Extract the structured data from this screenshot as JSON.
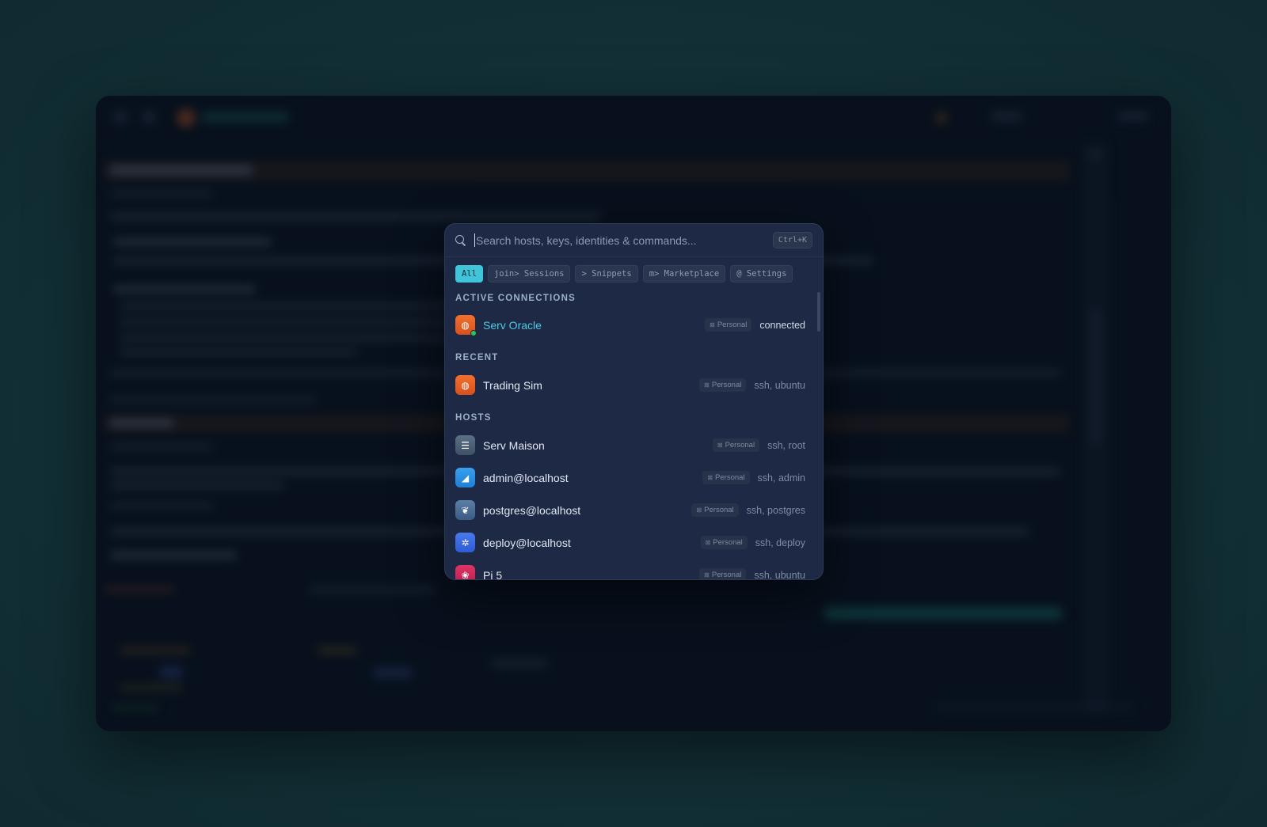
{
  "search": {
    "placeholder": "Search hosts, keys, identities & commands...",
    "shortcut": "Ctrl+K"
  },
  "filters": [
    {
      "label": "All",
      "active": true
    },
    {
      "label": "join> Sessions"
    },
    {
      "label": "> Snippets"
    },
    {
      "label": "m> Marketplace"
    },
    {
      "label": "@ Settings"
    }
  ],
  "sections": {
    "active": {
      "title": "ACTIVE CONNECTIONS",
      "items": [
        {
          "name": "Serv Oracle",
          "icon": "ubuntu-icon",
          "tag": "Personal",
          "meta": "connected",
          "online": true
        }
      ]
    },
    "recent": {
      "title": "RECENT",
      "items": [
        {
          "name": "Trading Sim",
          "icon": "ubuntu-icon",
          "tag": "Personal",
          "meta": "ssh, ubuntu"
        }
      ]
    },
    "hosts": {
      "title": "HOSTS",
      "items": [
        {
          "name": "Serv Maison",
          "icon": "server-icon",
          "tag": "Personal",
          "meta": "ssh, root"
        },
        {
          "name": "admin@localhost",
          "icon": "docker-icon",
          "tag": "Personal",
          "meta": "ssh, admin"
        },
        {
          "name": "postgres@localhost",
          "icon": "postgres-icon",
          "tag": "Personal",
          "meta": "ssh, postgres"
        },
        {
          "name": "deploy@localhost",
          "icon": "kubernetes-icon",
          "tag": "Personal",
          "meta": "ssh, deploy"
        },
        {
          "name": "Pi 5",
          "icon": "raspberry-pi-icon",
          "tag": "Personal",
          "meta": "ssh, ubuntu"
        }
      ]
    }
  },
  "colors": {
    "accent": "#3fc5d9",
    "online": "#31c45b"
  }
}
